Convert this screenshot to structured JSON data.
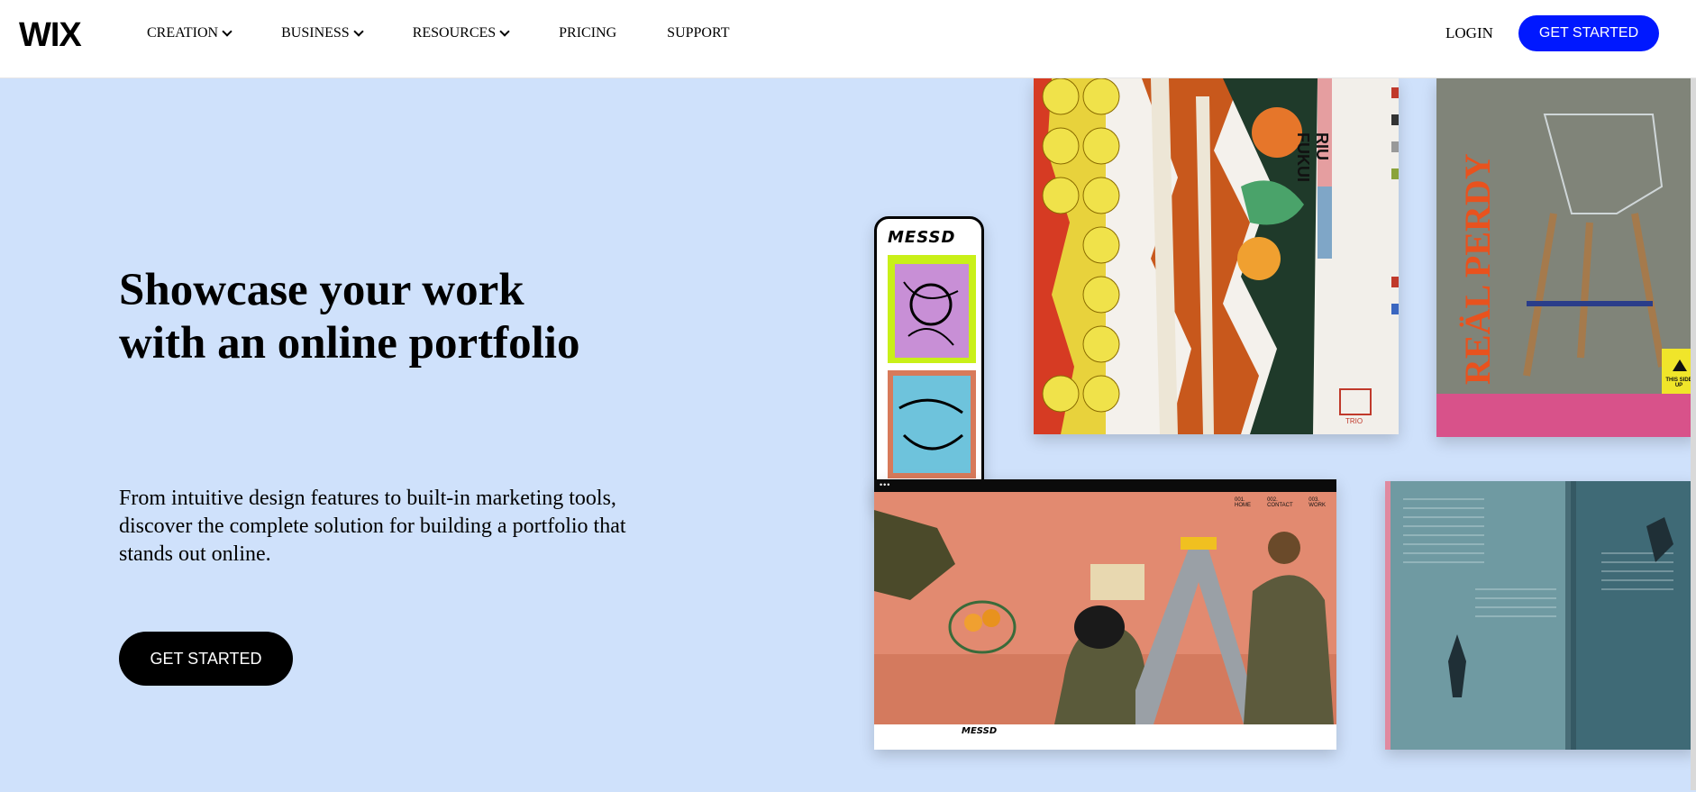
{
  "header": {
    "logo": "WIX",
    "nav": [
      {
        "label": "CREATION",
        "dropdown": true
      },
      {
        "label": "BUSINESS",
        "dropdown": true
      },
      {
        "label": "RESOURCES",
        "dropdown": true
      },
      {
        "label": "PRICING",
        "dropdown": false
      },
      {
        "label": "SUPPORT",
        "dropdown": false
      }
    ],
    "login": "LOGIN",
    "get_started": "GET STARTED"
  },
  "hero": {
    "headline": "Showcase your work with an online portfolio",
    "subtext": "From intuitive design features to built-in marketing tools, discover the complete solution for building a portfolio that stands out online.",
    "get_started": "GET STARTED"
  },
  "colors": {
    "hero_bg": "#cfe1fb",
    "accent_blue": "#0018ff",
    "black": "#000000"
  },
  "portfolio": {
    "phone_brand": "MESSD",
    "poster_title": "RIU FUKUI",
    "poster_logo": "TRIO",
    "magazine_title": "REÄL PERDY",
    "magazine_sticker": "THIS SIDE UP",
    "desktop_brand": "MESSD",
    "desktop_nav": [
      "001. HOME",
      "002. CONTACT",
      "003. WORK"
    ]
  }
}
